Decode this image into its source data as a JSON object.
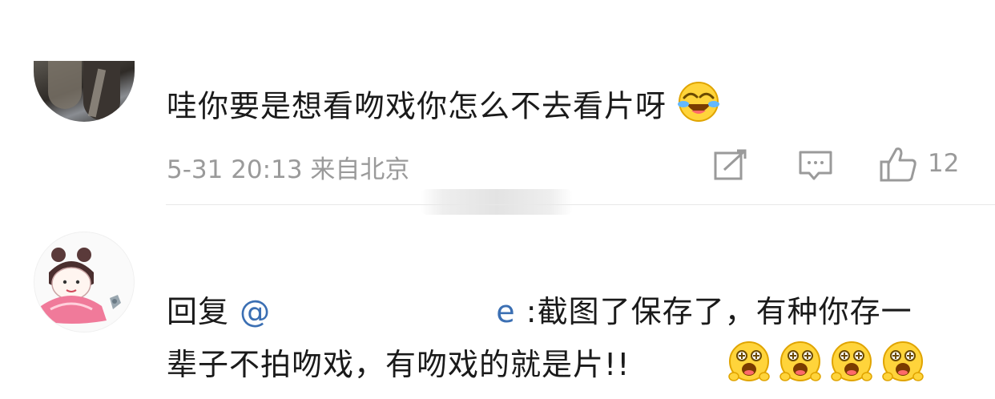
{
  "comment1": {
    "text": "哇你要是想看吻戏你怎么不去看片呀",
    "emoji": "laughing-crying-emoji",
    "timestamp": "5-31 20:13",
    "location": "来自北京",
    "like_count": "12",
    "icons": [
      "share-icon",
      "comment-icon",
      "thumbs-up-icon"
    ]
  },
  "comment2": {
    "reply_prefix": "回复",
    "mention": "@",
    "mention_tail": "e",
    "text_line1": ":截图了保存了，有种你存一",
    "text_line2": "辈子不拍吻戏，有吻戏的就是片!!",
    "emojis": [
      "grinning-starry-emoji",
      "grinning-starry-emoji",
      "grinning-starry-emoji",
      "grinning-starry-emoji"
    ]
  },
  "colors": {
    "mention": "#3b6fb3",
    "meta": "#9a9a9a",
    "divider": "#e8e8e8"
  }
}
